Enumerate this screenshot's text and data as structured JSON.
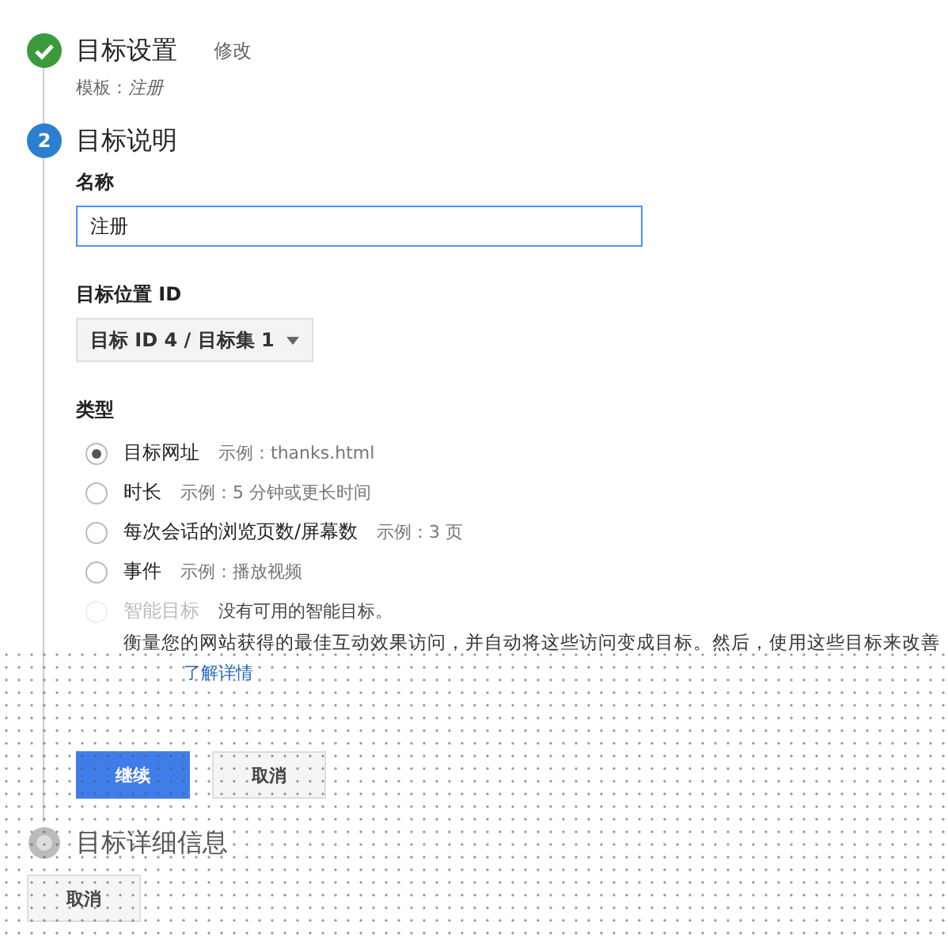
{
  "steps": [
    {
      "kind": "done",
      "title": "目标设置",
      "edit_link": "修改",
      "template_label": "模板：",
      "template_value": "注册"
    },
    {
      "kind": "current",
      "number": "2",
      "title": "目标说明",
      "name_field": {
        "label": "名称",
        "value": "注册"
      },
      "slot": {
        "label": "目标位置 ID",
        "value": "目标 ID 4 / 目标集 1"
      },
      "type": {
        "label": "类型",
        "options": [
          {
            "label": "目标网址",
            "example": "示例：thanks.html",
            "selected": true,
            "disabled": false
          },
          {
            "label": "时长",
            "example": "示例：5 分钟或更长时间",
            "selected": false,
            "disabled": false
          },
          {
            "label": "每次会话的浏览页数/屏幕数",
            "example": "示例：3 页",
            "selected": false,
            "disabled": false
          },
          {
            "label": "事件",
            "example": "示例：播放视频",
            "selected": false,
            "disabled": false
          },
          {
            "label": "智能目标",
            "example": "没有可用的智能目标。",
            "selected": false,
            "disabled": true,
            "description": "衡量您的网站获得的最佳互动效果访问，并自动将这些访问变成目标。然后，使用这些目标来改善",
            "link": "了解详情"
          }
        ]
      },
      "buttons": [
        {
          "label": "继续",
          "primary": true
        },
        {
          "label": "取消",
          "primary": false
        }
      ]
    },
    {
      "kind": "pending",
      "title": "目标详细信息"
    }
  ],
  "footer_button": "取消"
}
